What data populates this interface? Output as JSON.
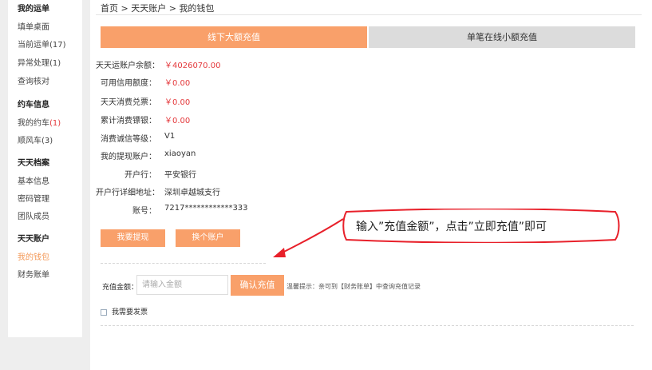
{
  "sidebar": {
    "groups": [
      {
        "title": "我的运单",
        "items": [
          {
            "label": "填单桌面",
            "count": ""
          },
          {
            "label": "当前运单(17)",
            "count": ""
          },
          {
            "label": "异常处理(1)",
            "count": ""
          },
          {
            "label": "查询核对",
            "count": ""
          }
        ]
      },
      {
        "title": "约车信息",
        "items": [
          {
            "label": "我的约车",
            "count": "(1)"
          },
          {
            "label": "顺风车(3)",
            "count": ""
          }
        ]
      },
      {
        "title": "天天档案",
        "items": [
          {
            "label": "基本信息",
            "count": ""
          },
          {
            "label": "密码管理",
            "count": ""
          },
          {
            "label": "团队成员",
            "count": ""
          }
        ]
      },
      {
        "title": "天天账户",
        "items": [
          {
            "label": "我的钱包",
            "count": ""
          },
          {
            "label": "财务账单",
            "count": ""
          }
        ]
      }
    ]
  },
  "breadcrumb": {
    "home": "首页",
    "sep1": " > ",
    "account": "天天账户",
    "sep2": " > ",
    "current": "我的钱包"
  },
  "tabs": {
    "offline": "线下大额充值",
    "online": "单笔在线小额充值"
  },
  "info": {
    "balance_label": "天天运账户余额：",
    "balance_value": "￥4026070.00",
    "credit_label": "可用信用额度：",
    "credit_value": "￥0.00",
    "voucher_label": "天天消费兑票：",
    "voucher_value": "￥0.00",
    "silver_label": "累计消费镖银：",
    "silver_value": "￥0.00",
    "level_label": "消费诚信等级：",
    "level_value": "V1",
    "withdraw_account_label": "我的提现账户：",
    "withdraw_account_value": "xiaoyan",
    "bank_label": "开户行：",
    "bank_value": "平安银行",
    "bank_addr_label": "开户行详细地址：",
    "bank_addr_value": "深圳卓越城支行",
    "account_no_label": "账号：",
    "account_no_value": "7217************333"
  },
  "buttons": {
    "withdraw": "我要提现",
    "change_account": "换个账户",
    "confirm_recharge": "确认充值"
  },
  "recharge": {
    "label": "充值金额：",
    "placeholder": "请输入金额",
    "tip": "温馨提示：亲可到【财务账单】中查询充值记录"
  },
  "invoice": {
    "label": "我需要发票"
  },
  "annotation": {
    "text": "输入”充值金额”，点击”立即充值”即可"
  },
  "colors": {
    "accent": "#f9a06a",
    "red": "#e4393c",
    "annotation_red": "#e8202a"
  }
}
